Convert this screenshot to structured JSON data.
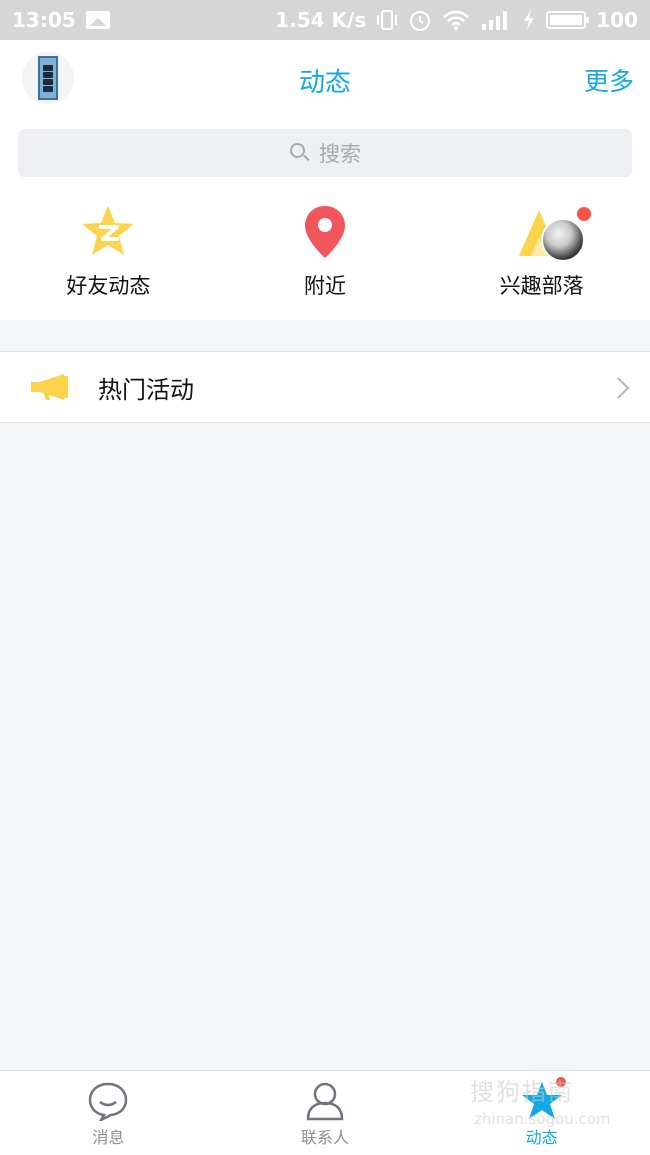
{
  "status_bar": {
    "time": "13:05",
    "net_speed": "1.54 K/s",
    "battery": "100"
  },
  "header": {
    "title": "动态",
    "more": "更多"
  },
  "search": {
    "placeholder": "搜索"
  },
  "quick_entries": [
    {
      "label": "好友动态",
      "icon": "qzone-star-icon"
    },
    {
      "label": "附近",
      "icon": "location-pin-icon"
    },
    {
      "label": "兴趣部落",
      "icon": "tribe-tent-icon"
    }
  ],
  "activity": {
    "label": "热门活动",
    "icon": "megaphone-icon"
  },
  "tabs": [
    {
      "label": "消息",
      "icon": "chat-bubble-icon"
    },
    {
      "label": "联系人",
      "icon": "person-icon"
    },
    {
      "label": "动态",
      "icon": "star-icon",
      "active": true
    }
  ],
  "watermark": {
    "text": "搜狗指南",
    "sub": "zhinan.sogou.com"
  },
  "colors": {
    "accent": "#12a8e4",
    "star": "#fcd34d",
    "pin": "#f0565c",
    "badge": "#f2554a"
  }
}
